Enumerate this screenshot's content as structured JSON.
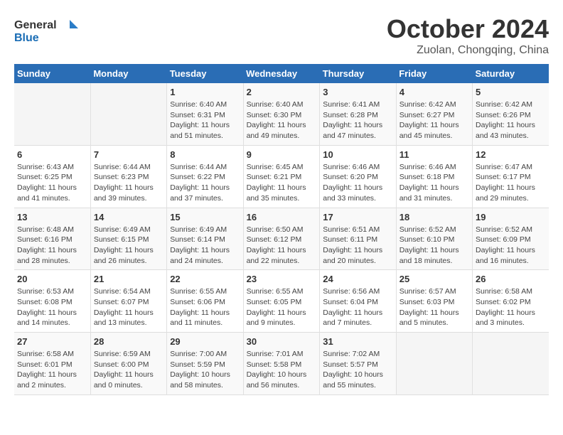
{
  "logo": {
    "line1": "General",
    "line2": "Blue"
  },
  "title": "October 2024",
  "location": "Zuolan, Chongqing, China",
  "days_header": [
    "Sunday",
    "Monday",
    "Tuesday",
    "Wednesday",
    "Thursday",
    "Friday",
    "Saturday"
  ],
  "weeks": [
    [
      {
        "day": "",
        "info": ""
      },
      {
        "day": "",
        "info": ""
      },
      {
        "day": "1",
        "info": "Sunrise: 6:40 AM\nSunset: 6:31 PM\nDaylight: 11 hours and 51 minutes."
      },
      {
        "day": "2",
        "info": "Sunrise: 6:40 AM\nSunset: 6:30 PM\nDaylight: 11 hours and 49 minutes."
      },
      {
        "day": "3",
        "info": "Sunrise: 6:41 AM\nSunset: 6:28 PM\nDaylight: 11 hours and 47 minutes."
      },
      {
        "day": "4",
        "info": "Sunrise: 6:42 AM\nSunset: 6:27 PM\nDaylight: 11 hours and 45 minutes."
      },
      {
        "day": "5",
        "info": "Sunrise: 6:42 AM\nSunset: 6:26 PM\nDaylight: 11 hours and 43 minutes."
      }
    ],
    [
      {
        "day": "6",
        "info": "Sunrise: 6:43 AM\nSunset: 6:25 PM\nDaylight: 11 hours and 41 minutes."
      },
      {
        "day": "7",
        "info": "Sunrise: 6:44 AM\nSunset: 6:23 PM\nDaylight: 11 hours and 39 minutes."
      },
      {
        "day": "8",
        "info": "Sunrise: 6:44 AM\nSunset: 6:22 PM\nDaylight: 11 hours and 37 minutes."
      },
      {
        "day": "9",
        "info": "Sunrise: 6:45 AM\nSunset: 6:21 PM\nDaylight: 11 hours and 35 minutes."
      },
      {
        "day": "10",
        "info": "Sunrise: 6:46 AM\nSunset: 6:20 PM\nDaylight: 11 hours and 33 minutes."
      },
      {
        "day": "11",
        "info": "Sunrise: 6:46 AM\nSunset: 6:18 PM\nDaylight: 11 hours and 31 minutes."
      },
      {
        "day": "12",
        "info": "Sunrise: 6:47 AM\nSunset: 6:17 PM\nDaylight: 11 hours and 29 minutes."
      }
    ],
    [
      {
        "day": "13",
        "info": "Sunrise: 6:48 AM\nSunset: 6:16 PM\nDaylight: 11 hours and 28 minutes."
      },
      {
        "day": "14",
        "info": "Sunrise: 6:49 AM\nSunset: 6:15 PM\nDaylight: 11 hours and 26 minutes."
      },
      {
        "day": "15",
        "info": "Sunrise: 6:49 AM\nSunset: 6:14 PM\nDaylight: 11 hours and 24 minutes."
      },
      {
        "day": "16",
        "info": "Sunrise: 6:50 AM\nSunset: 6:12 PM\nDaylight: 11 hours and 22 minutes."
      },
      {
        "day": "17",
        "info": "Sunrise: 6:51 AM\nSunset: 6:11 PM\nDaylight: 11 hours and 20 minutes."
      },
      {
        "day": "18",
        "info": "Sunrise: 6:52 AM\nSunset: 6:10 PM\nDaylight: 11 hours and 18 minutes."
      },
      {
        "day": "19",
        "info": "Sunrise: 6:52 AM\nSunset: 6:09 PM\nDaylight: 11 hours and 16 minutes."
      }
    ],
    [
      {
        "day": "20",
        "info": "Sunrise: 6:53 AM\nSunset: 6:08 PM\nDaylight: 11 hours and 14 minutes."
      },
      {
        "day": "21",
        "info": "Sunrise: 6:54 AM\nSunset: 6:07 PM\nDaylight: 11 hours and 13 minutes."
      },
      {
        "day": "22",
        "info": "Sunrise: 6:55 AM\nSunset: 6:06 PM\nDaylight: 11 hours and 11 minutes."
      },
      {
        "day": "23",
        "info": "Sunrise: 6:55 AM\nSunset: 6:05 PM\nDaylight: 11 hours and 9 minutes."
      },
      {
        "day": "24",
        "info": "Sunrise: 6:56 AM\nSunset: 6:04 PM\nDaylight: 11 hours and 7 minutes."
      },
      {
        "day": "25",
        "info": "Sunrise: 6:57 AM\nSunset: 6:03 PM\nDaylight: 11 hours and 5 minutes."
      },
      {
        "day": "26",
        "info": "Sunrise: 6:58 AM\nSunset: 6:02 PM\nDaylight: 11 hours and 3 minutes."
      }
    ],
    [
      {
        "day": "27",
        "info": "Sunrise: 6:58 AM\nSunset: 6:01 PM\nDaylight: 11 hours and 2 minutes."
      },
      {
        "day": "28",
        "info": "Sunrise: 6:59 AM\nSunset: 6:00 PM\nDaylight: 11 hours and 0 minutes."
      },
      {
        "day": "29",
        "info": "Sunrise: 7:00 AM\nSunset: 5:59 PM\nDaylight: 10 hours and 58 minutes."
      },
      {
        "day": "30",
        "info": "Sunrise: 7:01 AM\nSunset: 5:58 PM\nDaylight: 10 hours and 56 minutes."
      },
      {
        "day": "31",
        "info": "Sunrise: 7:02 AM\nSunset: 5:57 PM\nDaylight: 10 hours and 55 minutes."
      },
      {
        "day": "",
        "info": ""
      },
      {
        "day": "",
        "info": ""
      }
    ]
  ]
}
